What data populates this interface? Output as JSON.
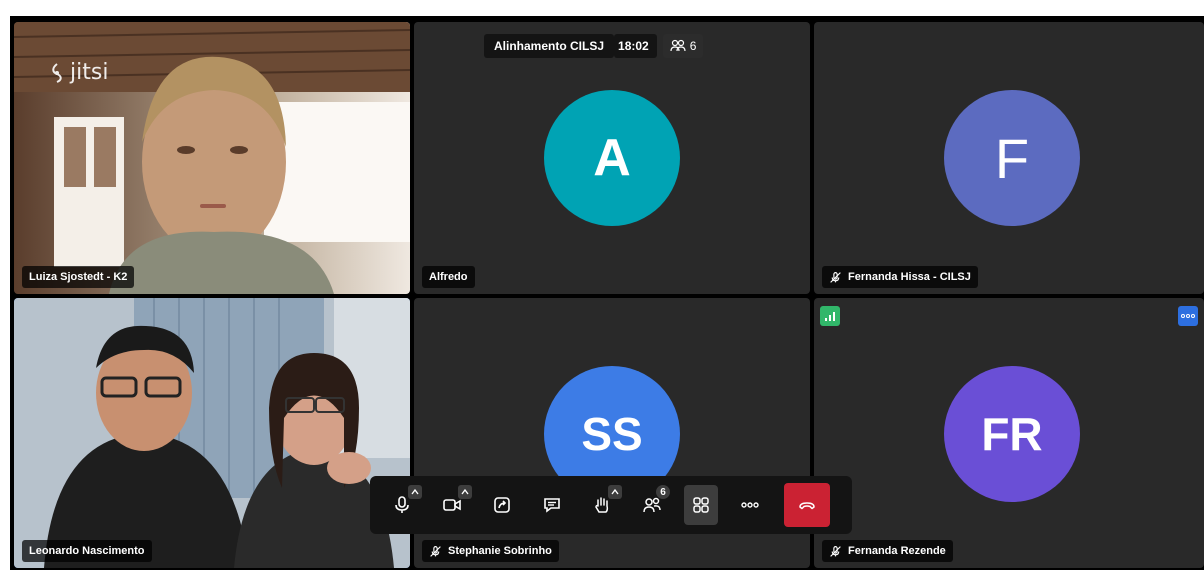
{
  "app": {
    "logo_text": "jitsi"
  },
  "meeting": {
    "title": "Alinhamento CILSJ",
    "time": "18:02",
    "participant_count": "6"
  },
  "tiles": {
    "luiza": {
      "name": "Luiza Sjostedt - K2"
    },
    "alfredo": {
      "name": "Alfredo",
      "initials": "A",
      "color": "#00a3b4"
    },
    "fernanda_h": {
      "name": "Fernanda Hissa - CILSJ",
      "initials": "F",
      "color": "#5c6bc0"
    },
    "leonardo": {
      "name": "Leonardo Nascimento"
    },
    "stephanie": {
      "name": "Stephanie Sobrinho",
      "initials": "SS",
      "color": "#3d7ce6"
    },
    "fernanda_r": {
      "name": "Fernanda Rezende",
      "initials": "FR",
      "color": "#6a4fd6"
    }
  },
  "toolbar": {
    "participants_badge": "6"
  },
  "colors": {
    "accent": "#4687ed",
    "hangup": "#cb2233",
    "connection_good": "#31b76a",
    "more_button": "#2d6fe0"
  }
}
